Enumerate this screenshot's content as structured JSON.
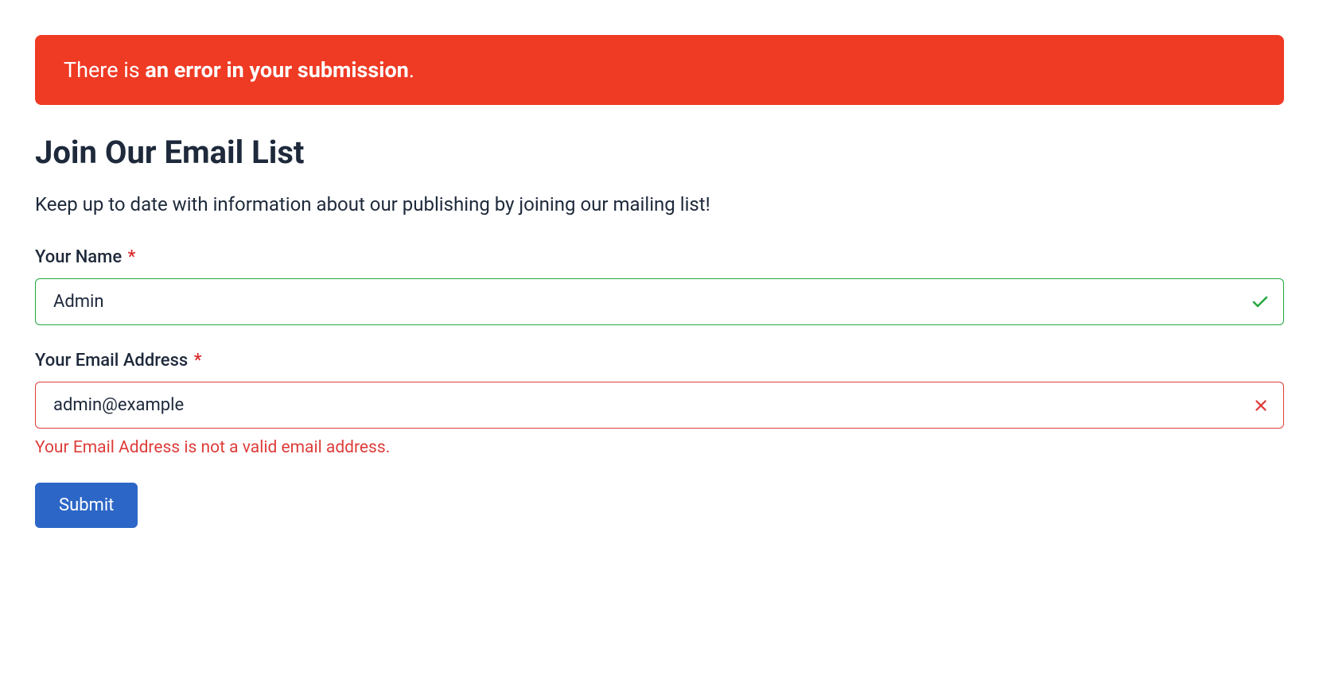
{
  "alert": {
    "prefix": "There is ",
    "emphasis": "an error in your submission",
    "suffix": "."
  },
  "form": {
    "title": "Join Our Email List",
    "description": "Keep up to date with information about our publishing by joining our mailing list!",
    "fields": {
      "name": {
        "label": "Your Name",
        "required_marker": "*",
        "value": "Admin"
      },
      "email": {
        "label": "Your Email Address",
        "required_marker": "*",
        "value": "admin@example",
        "error": "Your Email Address is not a valid email address."
      }
    },
    "submit_label": "Submit"
  }
}
